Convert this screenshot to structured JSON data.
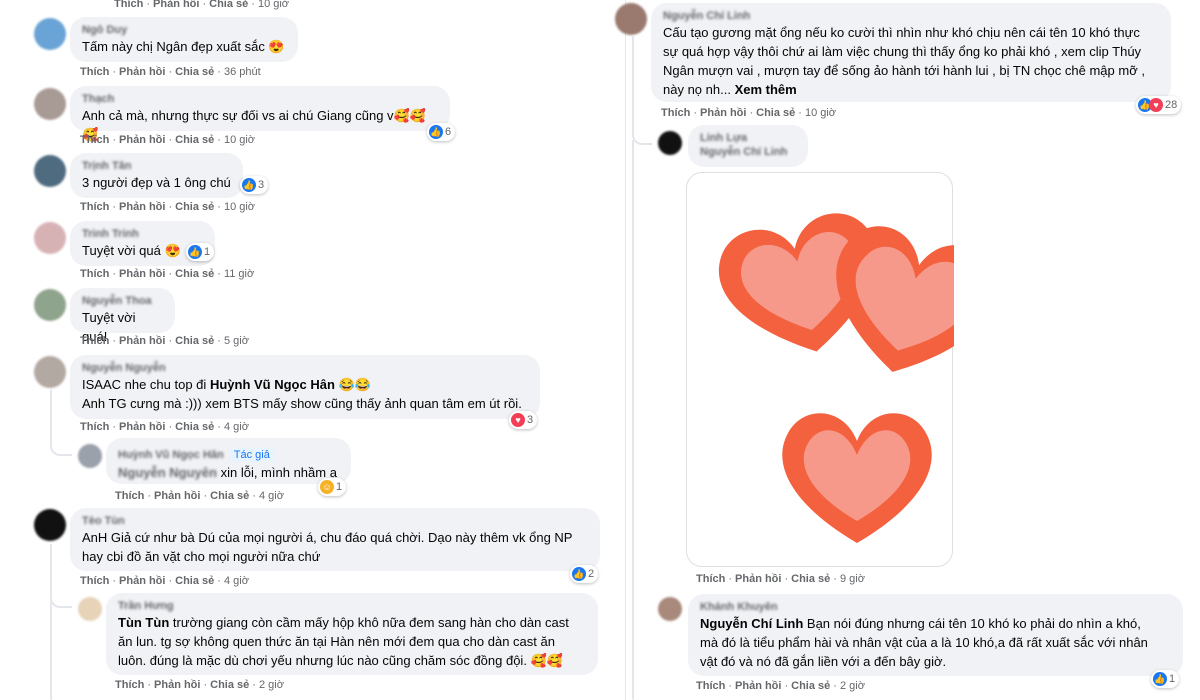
{
  "actions": {
    "like": "Thích",
    "reply": "Phản hồi",
    "share": "Chia sẻ"
  },
  "left": {
    "top_actions_time": "10 giờ",
    "c1": {
      "author": "Ngô Duy",
      "text": "Tấm này chị Ngân đẹp xuất sắc 😍",
      "time": "36 phút"
    },
    "c2": {
      "author": "Thạch",
      "text": "Anh cả mà, nhưng thực sự đối vs ai chú Giang cũng v🥰🥰🥰",
      "time": "10 giờ",
      "react_count": "6"
    },
    "c3": {
      "author": "Trịnh Tân",
      "text": "3 người đẹp và 1 ông chú",
      "time": "10 giờ",
      "react_count": "3"
    },
    "c4": {
      "author": "Trinh Trinh",
      "text": "Tuyệt vời quá 😍",
      "time": "11 giờ",
      "react_count": "1"
    },
    "c5": {
      "author": "Nguyễn Thoa",
      "text": "Tuyệt vời quá!",
      "time": "5 giờ"
    },
    "c6": {
      "author": "Nguyễn Nguyễn",
      "line1_prefix": "ISAAC nhe chu top đi",
      "mention": "Huỳnh Vũ Ngọc Hân",
      "line1_suffix": "😂😂",
      "line2": "Anh TG cưng mà :))) xem BTS mấy show cũng thấy ảnh quan tâm em út rồi.",
      "time": "4 giờ",
      "react_count": "3"
    },
    "c7": {
      "author": "Huỳnh Vũ Ngọc Hân",
      "badge": "Tác giả",
      "mention": "Nguyễn Nguyên",
      "text": "xin lỗi, mình nhầm ạ",
      "time": "4 giờ",
      "react_count": "1"
    },
    "c8": {
      "author": "Tèo Tùn",
      "line1": "AnH Giả cứ như bà Dú của mọi người á, chu đáo quá chời. Dạo này thêm vk ổng NP",
      "line2": "hay cbi đồ ăn vặt cho mọi người nữa chứ",
      "time": "4 giờ",
      "react_count": "2"
    },
    "c9": {
      "author": "Trần Hưng",
      "mention": "Tùn Tùn",
      "line1": "trường giang còn cầm mấy hộp khô nữa đem sang hàn cho dàn cast",
      "line2": "ăn lun. tg sợ không quen thức ăn tại Hàn nên mới đem qua cho dàn cast ăn",
      "line3": "luôn. đúng là mặc dù chơi yếu nhưng lúc nào cũng chăm sóc đồng đội. 🥰🥰",
      "time": "2 giờ"
    }
  },
  "right": {
    "c1": {
      "author": "Nguyễn Chí Linh",
      "line1": "Cấu tạo gương mặt ổng nếu ko cười thì nhìn như khó chịu nên cái tên 10 khó thực",
      "line2": "sự quá hợp vậy thôi chứ ai làm việc chung thì thấy ổng ko phải khó , xem clip Thúy",
      "line3": "Ngân mượn vai , mượn tay để sống ảo hành tới hành lui , bị TN chọc chê mập mỡ ,",
      "line4": "này nọ nh...",
      "see_more": "Xem thêm",
      "time": "10 giờ",
      "react_count": "28"
    },
    "c2": {
      "author": "Linh Lựa",
      "mention": "Nguyễn Chí Linh",
      "time": "9 giờ"
    },
    "c3": {
      "author": "Khánh Khuyên",
      "mention": "Nguyễn Chí Linh",
      "line1": "Bạn nói đúng nhưng cái tên 10 khó ko phải do nhìn a khó,",
      "line2": "mà đó là tiểu phẩm hài và nhân vật của a là 10 khó,a đã rất xuất sắc với nhân",
      "line3": "vật đó và nó đã gắn liền với a đến bây giờ.",
      "time": "2 giờ",
      "react_count": "1"
    }
  },
  "colors": {
    "heart_outer": "#f4613f",
    "heart_inner": "#f6998a",
    "link_blue": "#1877f2"
  },
  "icons": {
    "like": "like-icon",
    "love": "love-icon",
    "care": "care-icon"
  }
}
